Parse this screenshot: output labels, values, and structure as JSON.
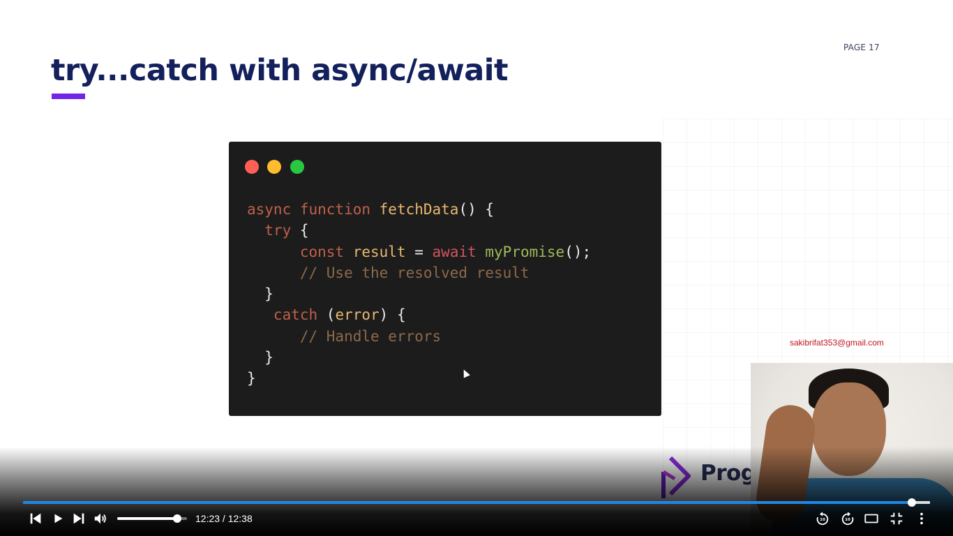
{
  "slide": {
    "page_label": "PAGE 17",
    "title": "try...catch with async/await",
    "accent_color": "#7125e8",
    "code_lines": [
      [
        {
          "t": "async ",
          "c": "kw"
        },
        {
          "t": "function ",
          "c": "kw"
        },
        {
          "t": "fetchData",
          "c": "fn"
        },
        {
          "t": "() {",
          "c": "pn"
        }
      ],
      [
        {
          "t": "  try ",
          "c": "kw"
        },
        {
          "t": "{",
          "c": "pn"
        }
      ],
      [
        {
          "t": "      const ",
          "c": "kw"
        },
        {
          "t": "result ",
          "c": "fn"
        },
        {
          "t": "= ",
          "c": "pn"
        },
        {
          "t": "await ",
          "c": "kw2"
        },
        {
          "t": "myPromise",
          "c": "fn2"
        },
        {
          "t": "();",
          "c": "pn"
        }
      ],
      [
        {
          "t": "      // Use the resolved result",
          "c": "cm"
        }
      ],
      [
        {
          "t": "  }",
          "c": "pn"
        }
      ],
      [
        {
          "t": "   catch ",
          "c": "kw"
        },
        {
          "t": "(",
          "c": "pn"
        },
        {
          "t": "error",
          "c": "fn"
        },
        {
          "t": ") {",
          "c": "pn"
        }
      ],
      [
        {
          "t": "      // Handle errors",
          "c": "cm"
        }
      ],
      [
        {
          "t": "  }",
          "c": "pn"
        }
      ],
      [
        {
          "t": "}",
          "c": "pn"
        }
      ]
    ],
    "brand_name": "Programmino"
  },
  "overlay": {
    "email": "sakibrifat353@gmail.com"
  },
  "player": {
    "current_time": "12:23",
    "duration": "12:38",
    "time_text": "12:23 / 12:38",
    "progress_fraction": 0.98,
    "volume_fraction": 0.86,
    "accent_color": "#1e88e5",
    "controls": {
      "previous": "skip-previous-icon",
      "play": "play-icon",
      "next": "skip-next-icon",
      "volume": "volume-icon",
      "rewind": "rewind-10-icon",
      "forward": "forward-10-icon",
      "theater": "theater-mode-icon",
      "fullscreen": "exit-fullscreen-icon",
      "more": "more-vertical-icon"
    },
    "rewind_seconds": "10",
    "forward_seconds": "10"
  }
}
